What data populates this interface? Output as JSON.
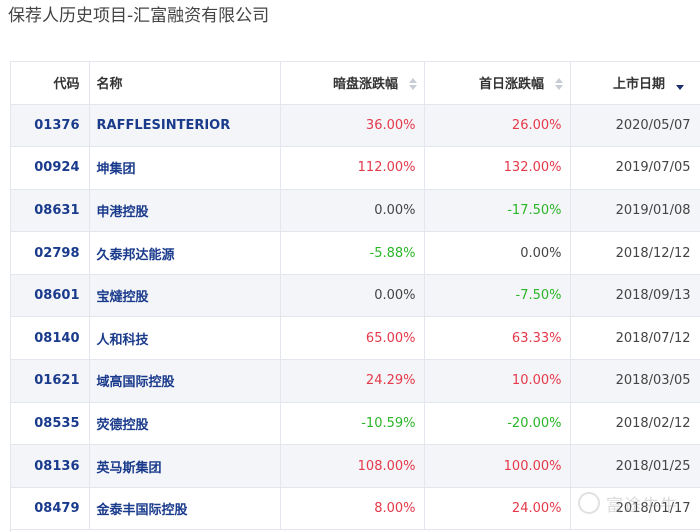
{
  "page": {
    "title": "保荐人历史项目-汇富融资有限公司"
  },
  "table": {
    "columns": {
      "code": "代码",
      "name": "名称",
      "grey_market": "暗盘涨跌幅",
      "first_day": "首日涨跌幅",
      "listing_date": "上市日期"
    },
    "rows": [
      {
        "code": "01376",
        "name": "RAFFLESINTERIOR",
        "grey": "36.00%",
        "grey_dir": "red",
        "first": "26.00%",
        "first_dir": "red",
        "date": "2020/05/07"
      },
      {
        "code": "00924",
        "name": "坤集团",
        "grey": "112.00%",
        "grey_dir": "red",
        "first": "132.00%",
        "first_dir": "red",
        "date": "2019/07/05"
      },
      {
        "code": "08631",
        "name": "申港控股",
        "grey": "0.00%",
        "grey_dir": "flat",
        "first": "-17.50%",
        "first_dir": "green",
        "date": "2019/01/08"
      },
      {
        "code": "02798",
        "name": "久泰邦达能源",
        "grey": "-5.88%",
        "grey_dir": "green",
        "first": "0.00%",
        "first_dir": "flat",
        "date": "2018/12/12"
      },
      {
        "code": "08601",
        "name": "宝燵控股",
        "grey": "0.00%",
        "grey_dir": "flat",
        "first": "-7.50%",
        "first_dir": "green",
        "date": "2018/09/13"
      },
      {
        "code": "08140",
        "name": "人和科技",
        "grey": "65.00%",
        "grey_dir": "red",
        "first": "63.33%",
        "first_dir": "red",
        "date": "2018/07/12"
      },
      {
        "code": "01621",
        "name": "域高国际控股",
        "grey": "24.29%",
        "grey_dir": "red",
        "first": "10.00%",
        "first_dir": "red",
        "date": "2018/03/05"
      },
      {
        "code": "08535",
        "name": "荧德控股",
        "grey": "-10.59%",
        "grey_dir": "green",
        "first": "-20.00%",
        "first_dir": "green",
        "date": "2018/02/12"
      },
      {
        "code": "08136",
        "name": "英马斯集团",
        "grey": "108.00%",
        "grey_dir": "red",
        "first": "100.00%",
        "first_dir": "red",
        "date": "2018/01/25"
      },
      {
        "code": "08479",
        "name": "金泰丰国际控股",
        "grey": "8.00%",
        "grey_dir": "red",
        "first": "24.00%",
        "first_dir": "red",
        "date": "2018/01/17"
      }
    ]
  },
  "colors": {
    "up": "#e4394a",
    "down": "#2bb528",
    "link": "#1a3b8c",
    "stripe": "#f4f5f8"
  },
  "icons": {
    "sort_idle": "sort-updown-icon",
    "sort_active": "sort-desc-icon"
  },
  "watermark": {
    "text": "富途牛牛"
  }
}
